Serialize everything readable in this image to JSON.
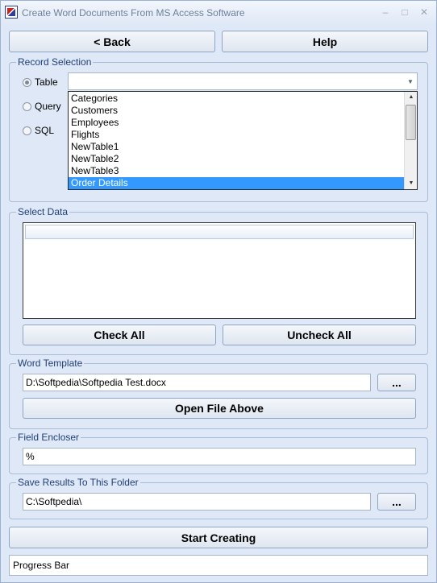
{
  "window": {
    "title": "Create Word Documents From MS Access Software",
    "min_symbol": "–",
    "max_symbol": "□",
    "close_symbol": "✕"
  },
  "nav": {
    "back_label": "< Back",
    "help_label": "Help"
  },
  "record_selection": {
    "title": "Record Selection",
    "options": [
      {
        "label": "Table",
        "checked": true
      },
      {
        "label": "Query",
        "checked": false
      },
      {
        "label": "SQL",
        "checked": false
      }
    ],
    "combo_value": "",
    "list_items": [
      "Categories",
      "Customers",
      "Employees",
      "Flights",
      "NewTable1",
      "NewTable2",
      "NewTable3",
      "Order Details"
    ],
    "selected_item": "Order Details"
  },
  "select_data": {
    "title": "Select Data",
    "check_all_label": "Check All",
    "uncheck_all_label": "Uncheck All"
  },
  "word_template": {
    "title": "Word Template",
    "path": "D:\\Softpedia\\Softpedia Test.docx",
    "browse_label": "...",
    "open_label": "Open File Above"
  },
  "field_encloser": {
    "title": "Field Encloser",
    "value": "%"
  },
  "save_results": {
    "title": "Save Results To This Folder",
    "path": "C:\\Softpedia\\",
    "browse_label": "..."
  },
  "actions": {
    "start_label": "Start Creating",
    "progress_text": "Progress Bar"
  }
}
